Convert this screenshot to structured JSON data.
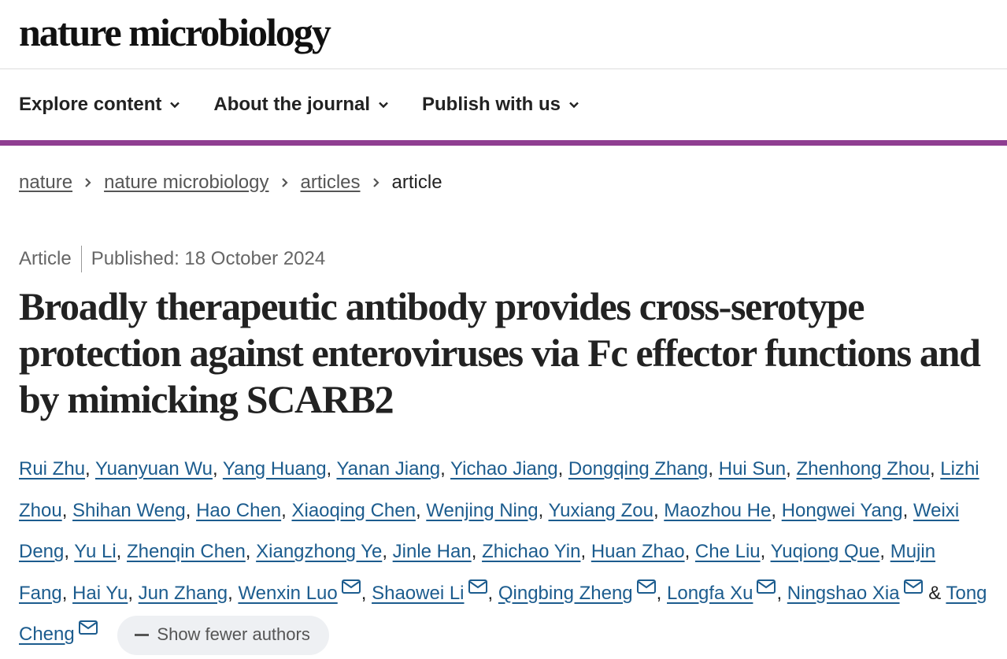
{
  "site": {
    "logo": "nature microbiology"
  },
  "nav": {
    "items": [
      {
        "label": "Explore content"
      },
      {
        "label": "About the journal"
      },
      {
        "label": "Publish with us"
      }
    ]
  },
  "breadcrumb": {
    "links": [
      "nature",
      "nature microbiology",
      "articles"
    ],
    "current": "article"
  },
  "article": {
    "type": "Article",
    "published": "Published: 18 October 2024",
    "title": "Broadly therapeutic antibody provides cross-serotype protection against enteroviruses via Fc effector functions and by mimicking SCARB2"
  },
  "authors": {
    "list": [
      {
        "name": "Rui Zhu",
        "mail": false
      },
      {
        "name": "Yuanyuan Wu",
        "mail": false
      },
      {
        "name": "Yang Huang",
        "mail": false
      },
      {
        "name": "Yanan Jiang",
        "mail": false
      },
      {
        "name": "Yichao Jiang",
        "mail": false
      },
      {
        "name": "Dongqing Zhang",
        "mail": false
      },
      {
        "name": "Hui Sun",
        "mail": false
      },
      {
        "name": "Zhenhong Zhou",
        "mail": false
      },
      {
        "name": "Lizhi Zhou",
        "mail": false
      },
      {
        "name": "Shihan Weng",
        "mail": false
      },
      {
        "name": "Hao Chen",
        "mail": false
      },
      {
        "name": "Xiaoqing Chen",
        "mail": false
      },
      {
        "name": "Wenjing Ning",
        "mail": false
      },
      {
        "name": "Yuxiang Zou",
        "mail": false
      },
      {
        "name": "Maozhou He",
        "mail": false
      },
      {
        "name": "Hongwei Yang",
        "mail": false
      },
      {
        "name": "Weixi Deng",
        "mail": false
      },
      {
        "name": "Yu Li",
        "mail": false
      },
      {
        "name": "Zhenqin Chen",
        "mail": false
      },
      {
        "name": "Xiangzhong Ye",
        "mail": false
      },
      {
        "name": "Jinle Han",
        "mail": false
      },
      {
        "name": "Zhichao Yin",
        "mail": false
      },
      {
        "name": "Huan Zhao",
        "mail": false
      },
      {
        "name": "Che Liu",
        "mail": false
      },
      {
        "name": "Yuqiong Que",
        "mail": false
      },
      {
        "name": "Mujin Fang",
        "mail": false
      },
      {
        "name": "Hai Yu",
        "mail": false
      },
      {
        "name": "Jun Zhang",
        "mail": false
      },
      {
        "name": "Wenxin Luo",
        "mail": true
      },
      {
        "name": "Shaowei Li",
        "mail": true
      },
      {
        "name": "Qingbing Zheng",
        "mail": true
      },
      {
        "name": "Longfa Xu",
        "mail": true
      },
      {
        "name": "Ningshao Xia",
        "mail": true
      },
      {
        "name": "Tong Cheng",
        "mail": true
      }
    ],
    "separator": ", ",
    "last_separator": " & ",
    "toggle_label": "Show fewer authors"
  },
  "colors": {
    "accent_bar": "#8f3e91",
    "author_link": "#1c5c8e",
    "toggle_bg": "#eef0f3"
  },
  "icons": {
    "nav_chevron": "chevron-down-icon",
    "breadcrumb_separator": "chevron-right-icon",
    "corresponding_author": "mail-icon",
    "toggle": "minus-icon"
  }
}
